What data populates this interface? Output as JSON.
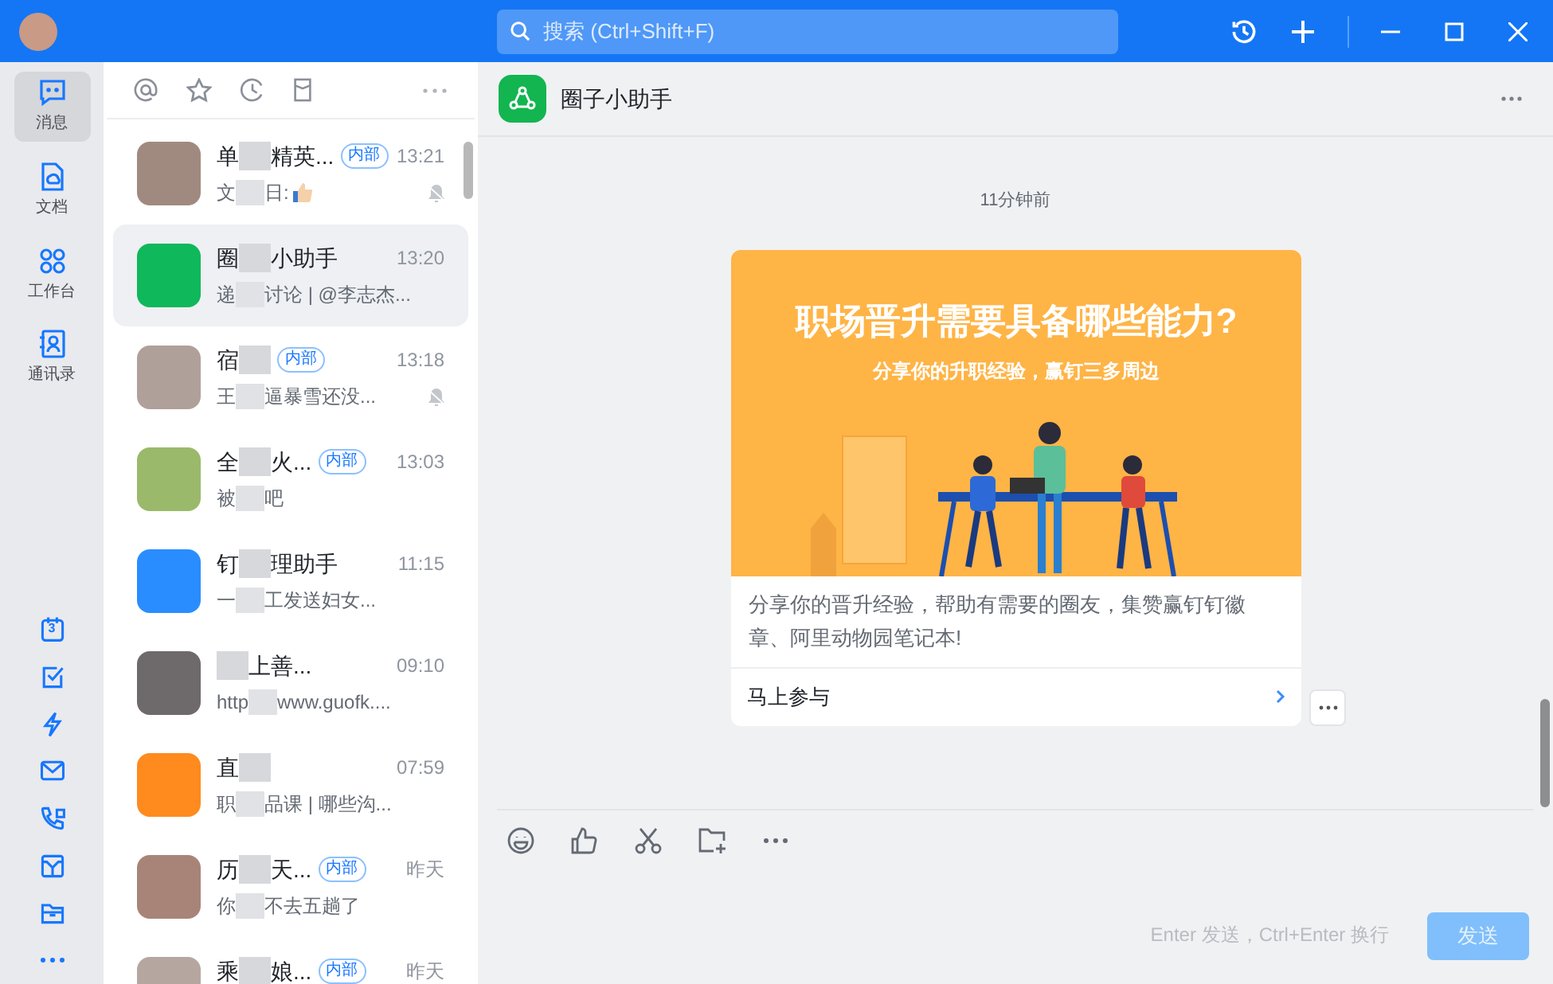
{
  "search": {
    "placeholder": "搜索 (Ctrl+Shift+F)"
  },
  "rail": [
    {
      "kind": "main",
      "label": "消息",
      "selected": true
    },
    {
      "kind": "main",
      "label": "文档",
      "selected": false
    },
    {
      "kind": "main",
      "label": "工作台",
      "selected": false
    },
    {
      "kind": "main",
      "label": "通讯录",
      "selected": false
    },
    {
      "kind": "tool",
      "calendar_day": "3",
      "selected": false
    },
    {
      "kind": "tool",
      "selected": false
    },
    {
      "kind": "tool",
      "selected": false
    },
    {
      "kind": "tool",
      "selected": false
    },
    {
      "kind": "tool",
      "selected": false
    },
    {
      "kind": "tool",
      "selected": false
    },
    {
      "kind": "tool",
      "selected": false
    },
    {
      "kind": "more",
      "selected": false
    }
  ],
  "chats": [
    {
      "name_start": "单",
      "name_end": "精英...",
      "badge": "内部",
      "time": "13:21",
      "preview_start": "文",
      "preview_end": "日:",
      "thumbs": true,
      "muted": true,
      "selected": false,
      "color": "#a08a80"
    },
    {
      "name_start": "圈",
      "name_end": "小助手",
      "time": "13:20",
      "preview_start": "递",
      "preview_end": "讨论 | @李志杰...",
      "muted": false,
      "selected": true,
      "color": "#0fb85a"
    },
    {
      "name_start": "宿",
      "badge": "内部",
      "time": "13:18",
      "preview_start": "王",
      "preview_end": "逼暴雪还没...",
      "muted": true,
      "selected": false,
      "color": "#b0a09a"
    },
    {
      "name_start": "全",
      "name_end": "火...",
      "badge": "内部",
      "time": "13:03",
      "preview_start": "被",
      "preview_end": "吧",
      "muted": false,
      "selected": false,
      "color": "#9ab96a"
    },
    {
      "name_start": "钉",
      "name_end": "理助手",
      "time": "11:15",
      "preview_start": "一",
      "preview_end": "工发送妇女...",
      "muted": false,
      "selected": false,
      "color": "#2a8dff"
    },
    {
      "name_end": "上善...",
      "time": "09:10",
      "preview_start": "http",
      "preview_end": "www.guofk....",
      "muted": false,
      "selected": false,
      "color": "#6e6a6c"
    },
    {
      "name_start": "直",
      "time": "07:59",
      "preview_start": "职",
      "preview_end": "品课 | 哪些沟...",
      "muted": false,
      "selected": false,
      "color": "#ff8a1e"
    },
    {
      "name_start": "历",
      "name_end": "天...",
      "badge": "内部",
      "time": "昨天",
      "preview_start": "你",
      "preview_end": "不去五趟了",
      "muted": false,
      "selected": false,
      "color": "#a88478"
    },
    {
      "name_start": "乘",
      "name_end": "娘...",
      "badge": "内部",
      "time": "昨天",
      "muted": false,
      "selected": false,
      "color": "#b5a7a0"
    }
  ],
  "conversation": {
    "title": "圈子小助手",
    "timestamp": "11分钟前",
    "card": {
      "banner_title": "职场晋升需要具备哪些能力?",
      "banner_subtitle": "分享你的升职经验，赢钉三多周边",
      "text": "分享你的晋升经验，帮助有需要的圈友，集赞赢钉钉徽章、阿里动物园笔记本!",
      "action": "马上参与"
    }
  },
  "composer": {
    "hint": "Enter 发送，Ctrl+Enter 换行",
    "send": "发送",
    "send_disabled": true
  }
}
